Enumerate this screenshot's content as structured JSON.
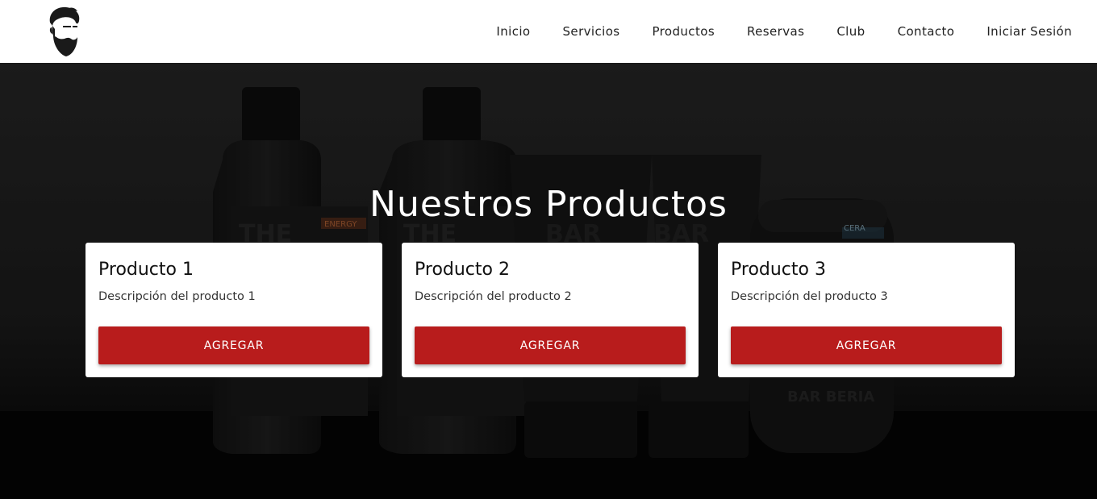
{
  "brand": {
    "logo_icon": "bearded-man-logo-icon"
  },
  "nav": {
    "items": [
      {
        "label": "Inicio"
      },
      {
        "label": "Servicios"
      },
      {
        "label": "Productos"
      },
      {
        "label": "Reservas"
      },
      {
        "label": "Club"
      },
      {
        "label": "Contacto"
      },
      {
        "label": "Iniciar Sesión"
      }
    ]
  },
  "hero": {
    "title": "Nuestros Productos",
    "background_image": "barber-products-photo",
    "bottle_labels": {
      "brand_word": "THE",
      "energy_tag": "ENERGY",
      "cera_tag": "CERA",
      "tube_word": "BAR",
      "jar_word": "BAR BERIA"
    }
  },
  "products": [
    {
      "title": "Producto 1",
      "description": "Descripción del producto 1",
      "button_label": "AGREGAR"
    },
    {
      "title": "Producto 2",
      "description": "Descripción del producto 2",
      "button_label": "AGREGAR"
    },
    {
      "title": "Producto 3",
      "description": "Descripción del producto 3",
      "button_label": "AGREGAR"
    }
  ],
  "colors": {
    "accent": "#b81c1c",
    "header_bg": "#ffffff",
    "card_bg": "#ffffff"
  }
}
